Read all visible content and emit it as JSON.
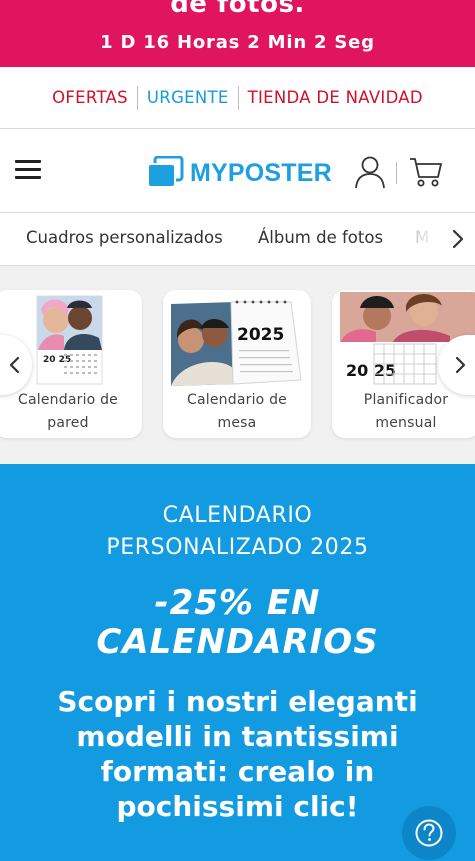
{
  "promo": {
    "title": "de fotos.",
    "countdown": "1 D  16 Horas  2 Min  2 Seg"
  },
  "top_links": [
    {
      "label": "OFERTAS",
      "color": "#d0112b"
    },
    {
      "label": "URGENTE",
      "color": "#1a9ad6"
    },
    {
      "label": "TIENDA DE NAVIDAD",
      "color": "#d0112b"
    }
  ],
  "header": {
    "brand": "MYPOSTER",
    "brand_color": "#1e9fe0",
    "icons": [
      "menu-icon",
      "user-icon",
      "cart-icon"
    ]
  },
  "categories": [
    "Cuadros personalizados",
    "Álbum de fotos",
    "M"
  ],
  "carousel": {
    "products": [
      {
        "label": "Calendario de pared",
        "year_text": "20 25"
      },
      {
        "label": "Calendario de mesa",
        "year_text": "2025"
      },
      {
        "label": "Planificador mensual",
        "year_text": "20 25"
      }
    ]
  },
  "hero": {
    "subtitle": "CALENDARIO PERSONALIZADO 2025",
    "offer": "-25% EN CALENDARIOS",
    "description": "Scopri i nostri eleganti modelli in tantissimi formati: crealo in pochissimi clic!",
    "background": "#129be0"
  },
  "colors": {
    "promo_bg": "#e0145f",
    "accent_red": "#d0112b",
    "accent_blue": "#1a9ad6"
  }
}
